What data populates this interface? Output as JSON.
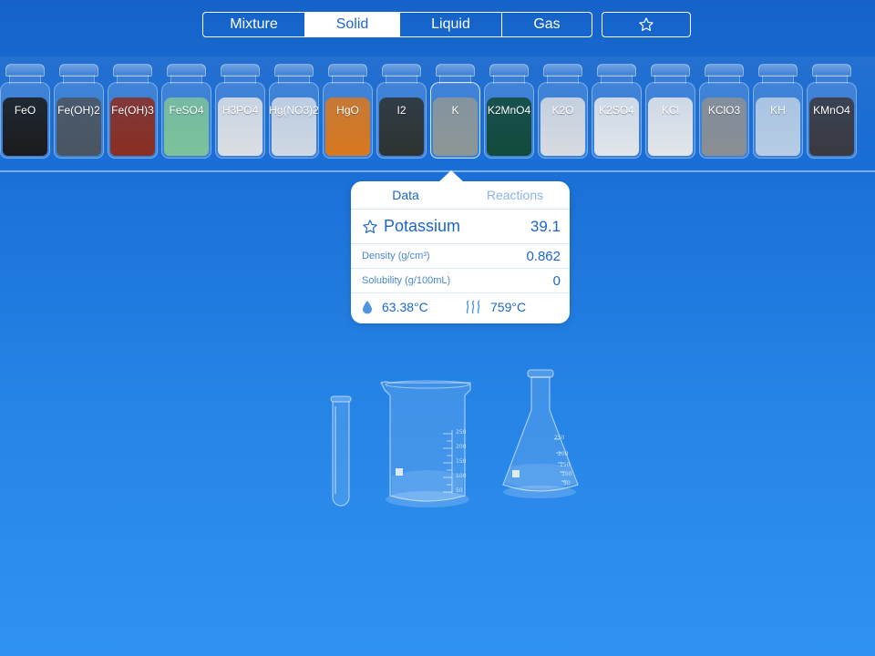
{
  "tabs": [
    {
      "label": "Mixture",
      "selected": false
    },
    {
      "label": "Solid",
      "selected": true
    },
    {
      "label": "Liquid",
      "selected": false
    },
    {
      "label": "Gas",
      "selected": false
    }
  ],
  "favorites_icon": "star-outline-icon",
  "jars": [
    {
      "formula": "FeO",
      "color": "#1b1b1b"
    },
    {
      "formula": "Fe(OH)2",
      "color": "#4b5560"
    },
    {
      "formula": "Fe(OH)3",
      "color": "#8a2e22"
    },
    {
      "formula": "FeSO4",
      "color": "#7dc29a"
    },
    {
      "formula": "H3PO4",
      "color": "#dcdfe3"
    },
    {
      "formula": "Hg(NO3)2",
      "color": "#cfd8e3"
    },
    {
      "formula": "HgO",
      "color": "#d9781e"
    },
    {
      "formula": "I2",
      "color": "#2e3230"
    },
    {
      "formula": "K",
      "color": "#8e9796",
      "selected": true
    },
    {
      "formula": "K2MnO4",
      "color": "#124a3a"
    },
    {
      "formula": "K2O",
      "color": "#d8dbe0"
    },
    {
      "formula": "K2SO4",
      "color": "#e2e6ea"
    },
    {
      "formula": "KCl",
      "color": "#e3e6e9"
    },
    {
      "formula": "KClO3",
      "color": "#8b8f93"
    },
    {
      "formula": "KH",
      "color": "#b8cde4"
    },
    {
      "formula": "KMnO4",
      "color": "#3a3940"
    }
  ],
  "popover": {
    "tabs": {
      "data": "Data",
      "reactions": "Reactions"
    },
    "name": "Potassium",
    "molar_mass": "39.1",
    "density_label": "Density (g/cm³)",
    "density_value": "0.862",
    "solubility_label": "Solubility (g/100mL)",
    "solubility_value": "0",
    "melting_point": "63.38°C",
    "boiling_point": "759°C"
  },
  "glassware": {
    "beaker_marks": [
      "250",
      "200",
      "150",
      "100",
      "50"
    ],
    "flask_marks": [
      "250",
      "200",
      "150",
      "100",
      "50"
    ]
  }
}
